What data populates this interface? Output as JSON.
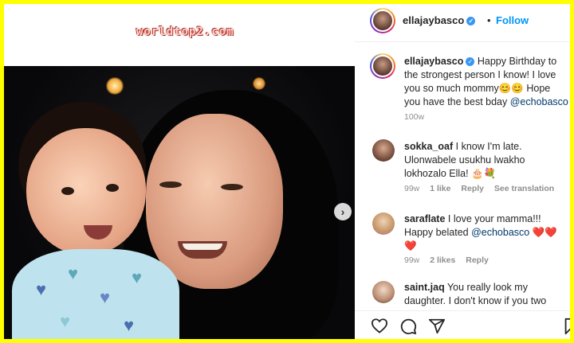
{
  "watermark": "worldtop2.com",
  "post": {
    "username": "ellajaybasco",
    "follow_label": "Follow",
    "dot": "•",
    "caption": {
      "username": "ellajaybasco",
      "text_before": "Happy Birthday to the strongest person I know! I love you so much mommy😊😊 Hope you have the best bday ",
      "mention": "@echobasco",
      "time": "100w"
    }
  },
  "comments": [
    {
      "username": "sokka_oaf",
      "text": "I know I'm late. Ulonwabele usukhu lwakho lokhozalo Ella! 🎂💐",
      "mention": "",
      "time": "99w",
      "likes": "1 like",
      "reply": "Reply",
      "translate": "See translation"
    },
    {
      "username": "saraflate",
      "text": "I love your mamma!!! Happy belated ",
      "mention": "@echobasco",
      "text_after": " ❤️❤️❤️",
      "time": "99w",
      "likes": "2 likes",
      "reply": "Reply"
    },
    {
      "username": "saint.jaq",
      "text": "You really look my daughter. I don't know if you two",
      "mention": ""
    }
  ],
  "icons": {
    "verified": "verified-badge",
    "like": "heart-icon",
    "comment": "comment-icon",
    "share": "share-icon",
    "save": "bookmark-icon",
    "next": "chevron-right-icon"
  },
  "colors": {
    "frame": "#ffff00",
    "link": "#0095f6",
    "mention": "#00376b",
    "verified": "#3897f0"
  }
}
